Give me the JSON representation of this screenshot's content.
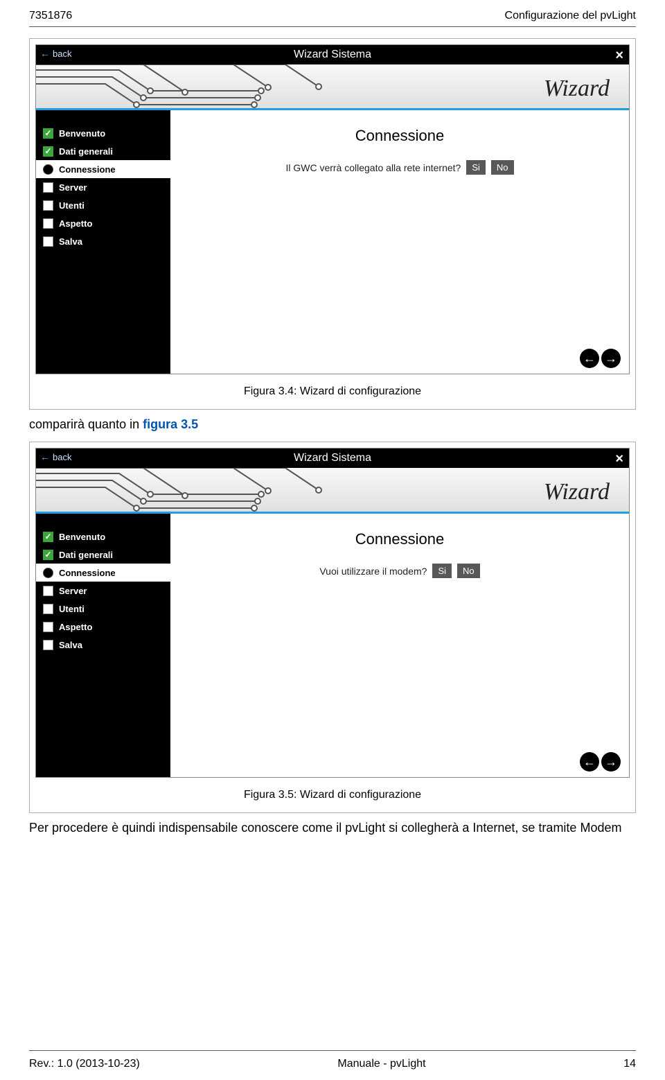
{
  "header": {
    "left": "7351876",
    "right": "Configurazione del pvLight"
  },
  "figure1": {
    "back_label": "back",
    "title": "Wizard Sistema",
    "banner_title": "Wizard",
    "content_title": "Connessione",
    "question": "Il GWC verrà collegato alla rete internet?",
    "btn_yes": "Si",
    "btn_no": "No",
    "steps": [
      {
        "label": "Benvenuto",
        "state": "checked"
      },
      {
        "label": "Dati generali",
        "state": "checked"
      },
      {
        "label": "Connessione",
        "state": "current"
      },
      {
        "label": "Server",
        "state": "empty"
      },
      {
        "label": "Utenti",
        "state": "empty"
      },
      {
        "label": "Aspetto",
        "state": "empty"
      },
      {
        "label": "Salva",
        "state": "empty"
      }
    ],
    "caption": "Figura 3.4: Wizard di configurazione"
  },
  "mid_text": {
    "prefix": "comparirà quanto in ",
    "link": "figura 3.5"
  },
  "figure2": {
    "back_label": "back",
    "title": "Wizard Sistema",
    "banner_title": "Wizard",
    "content_title": "Connessione",
    "question": "Vuoi utilizzare il modem?",
    "btn_yes": "Si",
    "btn_no": "No",
    "steps": [
      {
        "label": "Benvenuto",
        "state": "checked"
      },
      {
        "label": "Dati generali",
        "state": "checked"
      },
      {
        "label": "Connessione",
        "state": "current"
      },
      {
        "label": "Server",
        "state": "empty"
      },
      {
        "label": "Utenti",
        "state": "empty"
      },
      {
        "label": "Aspetto",
        "state": "empty"
      },
      {
        "label": "Salva",
        "state": "empty"
      }
    ],
    "caption": "Figura 3.5: Wizard di configurazione"
  },
  "bottom_text": "Per procedere è quindi indispensabile conoscere come il pvLight si collegherà a Internet, se tramite Modem",
  "footer": {
    "left": "Rev.: 1.0 (2013-10-23)",
    "center": "Manuale - pvLight",
    "right": "14"
  }
}
